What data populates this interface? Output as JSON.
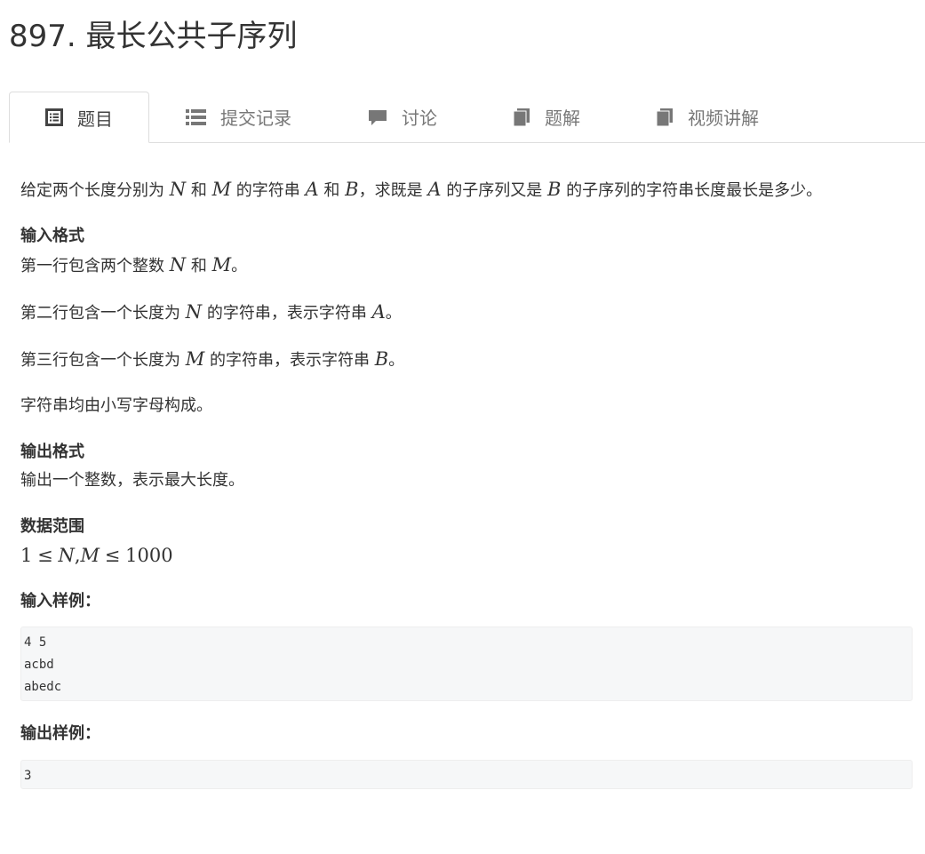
{
  "problem": {
    "title": "897. 最长公共子序列"
  },
  "tabs": [
    {
      "label": "题目",
      "icon": "list-box-icon",
      "active": true
    },
    {
      "label": "提交记录",
      "icon": "list-icon",
      "active": false
    },
    {
      "label": "讨论",
      "icon": "comment-icon",
      "active": false
    },
    {
      "label": "题解",
      "icon": "book-icon",
      "active": false
    },
    {
      "label": "视频讲解",
      "icon": "book-icon",
      "active": false
    }
  ],
  "statement": {
    "intro": {
      "t1": "给定两个长度分别为 ",
      "v1": "N",
      "t2": " 和 ",
      "v2": "M",
      "t3": " 的字符串 ",
      "v3": "A",
      "t4": " 和 ",
      "v4": "B",
      "t5": "，求既是 ",
      "v5": "A",
      "t6": " 的子序列又是 ",
      "v6": "B",
      "t7": " 的子序列的字符串长度最长是多少。"
    },
    "input_heading": "输入格式",
    "input_line1": {
      "t1": "第一行包含两个整数 ",
      "v1": "N",
      "t2": " 和 ",
      "v2": "M",
      "t3": "。"
    },
    "input_line2": {
      "t1": "第二行包含一个长度为 ",
      "v1": "N",
      "t2": " 的字符串，表示字符串 ",
      "v2": "A",
      "t3": "。"
    },
    "input_line3": {
      "t1": "第三行包含一个长度为 ",
      "v1": "M",
      "t2": " 的字符串，表示字符串 ",
      "v2": "B",
      "t3": "。"
    },
    "input_line4": "字符串均由小写字母构成。",
    "output_heading": "输出格式",
    "output_line": "输出一个整数，表示最大长度。",
    "range_heading": "数据范围",
    "range": {
      "a": "1",
      "le1": "≤",
      "v1": "N",
      "comma": ",",
      "v2": "M",
      "le2": "≤",
      "b": "1000"
    },
    "sample_input_heading": "输入样例：",
    "sample_input": "4 5\nacbd\nabedc",
    "sample_output_heading": "输出样例：",
    "sample_output": "3"
  }
}
